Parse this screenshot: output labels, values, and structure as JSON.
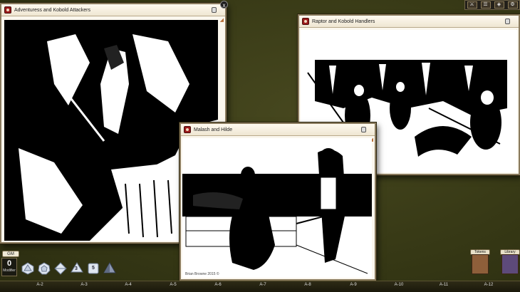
{
  "windows": [
    {
      "id": "w1",
      "title": "Adventuress and Kobold Attackers"
    },
    {
      "id": "w2",
      "title": "Raptor and Kobold Handlers"
    },
    {
      "id": "w3",
      "title": "Malash and Hilde",
      "caption": "Brian Browne 2015 ©"
    }
  ],
  "close_glyph": "x",
  "dice_tray": {
    "gm_label": "GM",
    "modifier_value": "0",
    "modifier_label": "Modifier",
    "dice": [
      {
        "name": "d20-icon",
        "label": ""
      },
      {
        "name": "d12-icon",
        "label": ""
      },
      {
        "name": "d10-icon",
        "label": ""
      },
      {
        "name": "d8-icon",
        "label": "3"
      },
      {
        "name": "d6-icon",
        "label": "5"
      },
      {
        "name": "d4-icon",
        "label": ""
      }
    ]
  },
  "hotkeys": [
    "A-2",
    "A-3",
    "A-4",
    "A-5",
    "A-6",
    "A-7",
    "A-8",
    "A-9",
    "A-10",
    "A-11",
    "A-12"
  ],
  "top_toolbar": {
    "buttons": [
      "⚔",
      "☰",
      "◈",
      "⚙"
    ]
  },
  "side_buttons": [
    {
      "name": "tokens-button",
      "label": "Tokens",
      "book_text": "TOK"
    },
    {
      "name": "library-button",
      "label": "Library",
      "book_text": ""
    }
  ],
  "colors": {
    "desktop": "#3a3b1c",
    "window_frame": "#8a7b5e",
    "title_icon": "#9b1a1a"
  }
}
